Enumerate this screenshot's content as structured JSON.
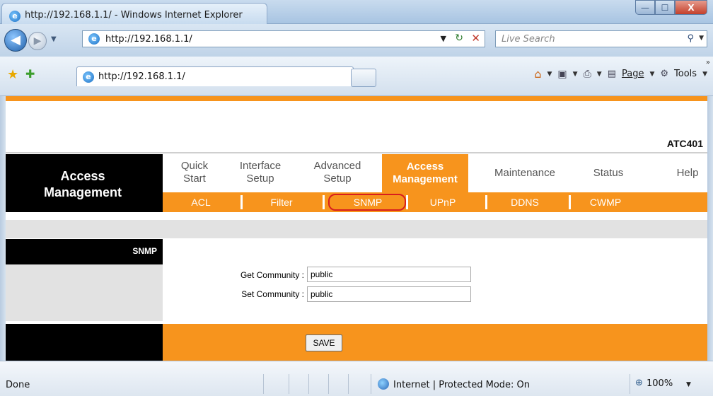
{
  "window": {
    "title": "http://192.168.1.1/ - Windows Internet Explorer",
    "min_glyph": "—",
    "max_glyph": "☐",
    "close_glyph": "X"
  },
  "address_bar": {
    "url": "http://192.168.1.1/",
    "search_placeholder": "Live Search"
  },
  "command_bar": {
    "tab_title": "http://192.168.1.1/",
    "page_label": "Page",
    "tools_label": "Tools",
    "icons": [
      "favorites-star-icon",
      "add-favorites-icon",
      "home-icon",
      "feeds-icon",
      "print-icon",
      "page-icon",
      "tools-icon"
    ]
  },
  "router": {
    "model": "ATC401",
    "section_title_line1": "Access",
    "section_title_line2": "Management",
    "main_nav": [
      {
        "line1": "Quick",
        "line2": "Start"
      },
      {
        "line1": "Interface",
        "line2": "Setup"
      },
      {
        "line1": "Advanced",
        "line2": "Setup"
      },
      {
        "line1": "Access",
        "line2": "Management",
        "active": true
      },
      {
        "line1": "Maintenance",
        "line2": ""
      },
      {
        "line1": "Status",
        "line2": ""
      },
      {
        "line1": "Help",
        "line2": ""
      }
    ],
    "sub_nav": [
      "ACL",
      "Filter",
      "SNMP",
      "UPnP",
      "DDNS",
      "CWMP"
    ],
    "sub_nav_selected": "SNMP",
    "panel_label": "SNMP",
    "form": {
      "get_label": "Get Community :",
      "get_value": "public",
      "set_label": "Set Community :",
      "set_value": "public"
    },
    "save_label": "SAVE",
    "colors": {
      "accent": "#f7941d",
      "header": "#000000",
      "band": "#e2e2e2"
    }
  },
  "status_bar": {
    "status": "Done",
    "zone": "Internet | Protected Mode: On",
    "zoom": "100%"
  }
}
